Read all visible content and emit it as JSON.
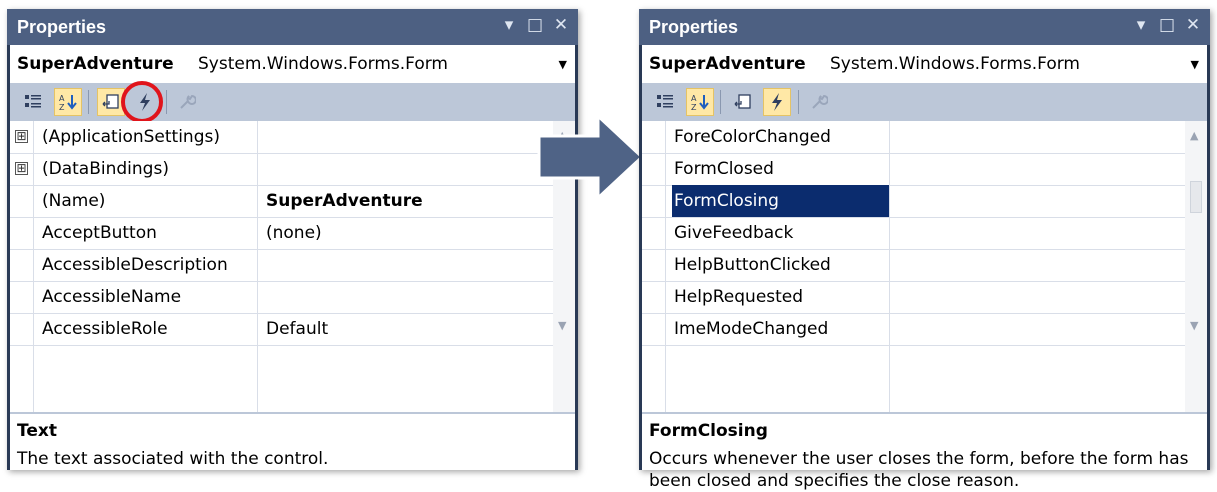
{
  "left_panel": {
    "title": "Properties",
    "title_icons": [
      "chevron-down-icon",
      "maximize-icon",
      "close-icon"
    ],
    "object_name": "SuperAdventure",
    "object_type": "System.Windows.Forms.Form",
    "toolbar": {
      "categorized": "categorized-icon",
      "alphabetical": "alphabetical-icon",
      "properties": "properties-icon",
      "events": "events-lightning-icon",
      "property_pages": "property-pages-wrench-icon"
    },
    "rows": [
      {
        "name": "(ApplicationSettings)",
        "value": "",
        "expandable": true
      },
      {
        "name": "(DataBindings)",
        "value": "",
        "expandable": true
      },
      {
        "name": "(Name)",
        "value": "SuperAdventure",
        "bold": true
      },
      {
        "name": "AcceptButton",
        "value": "(none)"
      },
      {
        "name": "AccessibleDescription",
        "value": ""
      },
      {
        "name": "AccessibleName",
        "value": ""
      },
      {
        "name": "AccessibleRole",
        "value": "Default"
      }
    ],
    "expander_symbol": "⊞",
    "description_title": "Text",
    "description_text": "The text associated with the control."
  },
  "right_panel": {
    "title": "Properties",
    "object_name": "SuperAdventure",
    "object_type": "System.Windows.Forms.Form",
    "rows": [
      {
        "name": "ForeColorChanged",
        "value": ""
      },
      {
        "name": "FormClosed",
        "value": ""
      },
      {
        "name": "FormClosing",
        "value": "",
        "selected": true
      },
      {
        "name": "GiveFeedback",
        "value": ""
      },
      {
        "name": "HelpButtonClicked",
        "value": ""
      },
      {
        "name": "HelpRequested",
        "value": ""
      },
      {
        "name": "ImeModeChanged",
        "value": ""
      }
    ],
    "description_title": "FormClosing",
    "description_text": "Occurs whenever the user closes the form, before the form has been closed and specifies the close reason."
  },
  "colors": {
    "title_bar": "#4d6082",
    "frame": "#293955",
    "toolbar": "#bcc7d8",
    "selection": "#0b2c6e",
    "active_button": "#ffe8a6",
    "highlight_circle": "#e0141b",
    "arrow": "#4f6386"
  }
}
